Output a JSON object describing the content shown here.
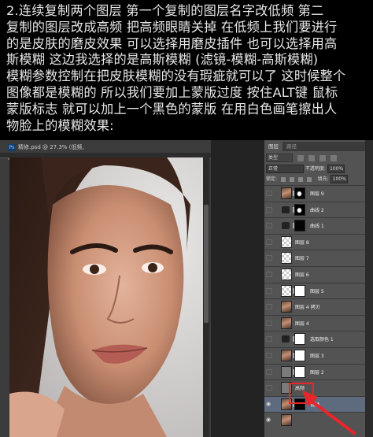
{
  "caption": {
    "lines": [
      "2.连续复制两个图层  第一个复制的图层名字改低频  第二",
      "复制的图层改成高频  把高频眼睛关掉  在低频上我们要进行",
      "的是皮肤的磨皮效果  可以选择用磨皮插件  也可以选择用高",
      "斯模糊    这边我选择的是高斯模糊  (滤镜-模糊-高斯模糊)",
      "模糊参数控制在把皮肤模糊的没有瑕疵就可以了  这时候整个",
      "图像都是模糊的  所以我们要加上蒙版过度    按住ALT键  鼠标",
      "蒙版标志  就可以加上一个黑色的蒙版  在用白色画笔擦出人",
      "物脸上的模糊效果:"
    ]
  },
  "document": {
    "ps_badge": "Ps",
    "tab_title": "精修.psd @ 27.3% (低频, RGB/8) *",
    "close_glyph": "×"
  },
  "layers_panel": {
    "tab_active": "图层",
    "tab_inactive": "路径",
    "filter_kind": "类型",
    "blend_mode": "正常",
    "opacity_label": "不透明度:",
    "opacity_value": "100%",
    "lock_label": "锁定:",
    "fill_label": "填充:",
    "fill_value": "100%",
    "layers": [
      {
        "name": "图层 9",
        "eye": false,
        "thumb": "face",
        "mask": "bmask"
      },
      {
        "name": "曲线 2",
        "eye": false,
        "thumb": "adj",
        "mask": "bmask"
      },
      {
        "name": "曲线 1",
        "eye": false,
        "thumb": "adj",
        "mask": "black"
      },
      {
        "name": "图层 8",
        "eye": false,
        "thumb": "check"
      },
      {
        "name": "图层 7",
        "eye": false,
        "thumb": "check"
      },
      {
        "name": "图层 6",
        "eye": false,
        "thumb": "check"
      },
      {
        "name": "图层 5",
        "eye": false,
        "thumb": "check",
        "mask": "white"
      },
      {
        "name": "图层 4 拷贝",
        "eye": false,
        "thumb": "face"
      },
      {
        "name": "图层 4",
        "eye": false,
        "thumb": "face"
      },
      {
        "name": "选取颜色 1",
        "eye": false,
        "thumb": "adj",
        "mask": "white"
      },
      {
        "name": "图层 3",
        "eye": false,
        "thumb": "face",
        "mask": "white"
      },
      {
        "name": "图层 2",
        "eye": false,
        "thumb": "gray",
        "mask": "white"
      },
      {
        "name": "高频",
        "eye": false,
        "thumb": "gray"
      },
      {
        "name": "低频",
        "eye": true,
        "thumb": "face",
        "mask": "black",
        "selected": true
      },
      {
        "name": "",
        "eye": true,
        "thumb": "face"
      }
    ]
  },
  "colors": {
    "annotation": "#e8262a",
    "panel_bg": "#535353",
    "selected_layer": "#5e6a7d"
  }
}
